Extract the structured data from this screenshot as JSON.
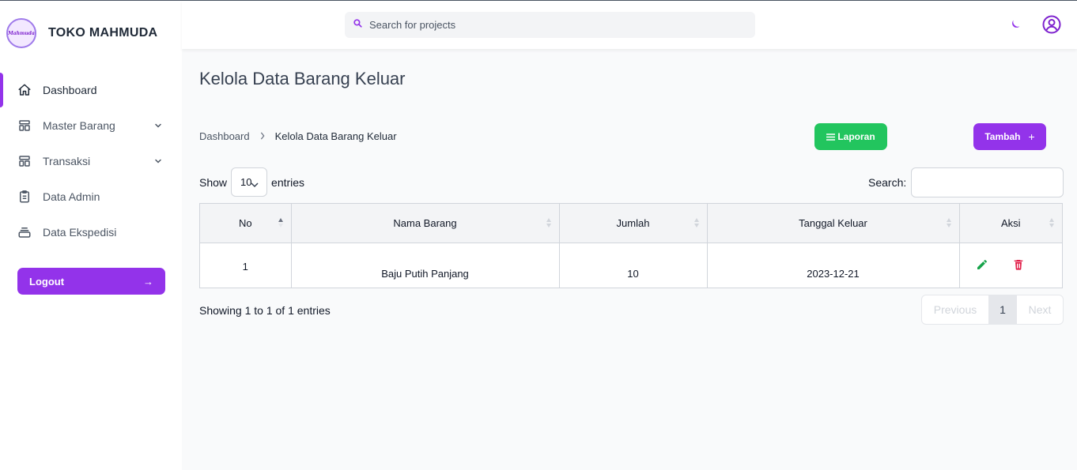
{
  "brand": {
    "logo_text": "Mahmuda",
    "name": "TOKO MAHMUDA"
  },
  "header": {
    "search_placeholder": "Search for projects"
  },
  "sidebar": {
    "items": [
      {
        "label": "Dashboard",
        "icon": "home-icon",
        "active": true
      },
      {
        "label": "Master Barang",
        "icon": "template-icon",
        "expandable": true
      },
      {
        "label": "Transaksi",
        "icon": "template-icon",
        "expandable": true
      },
      {
        "label": "Data Admin",
        "icon": "clipboard-icon"
      },
      {
        "label": "Data Ekspedisi",
        "icon": "archive-icon"
      }
    ],
    "logout_label": "Logout",
    "logout_arrow": "→"
  },
  "main": {
    "title": "Kelola Data Barang Keluar",
    "breadcrumb": {
      "home": "Dashboard",
      "current": "Kelola Data Barang Keluar"
    },
    "laporan_label": "Laporan",
    "tambah_label": "Tambah",
    "tambah_icon": "+"
  },
  "table_controls": {
    "show_label": "Show",
    "entries_value": "10",
    "entries_label": "entries",
    "search_label": "Search:"
  },
  "table": {
    "columns": [
      "No",
      "Nama Barang",
      "Jumlah",
      "Tanggal Keluar",
      "Aksi"
    ],
    "rows": [
      {
        "no": "1",
        "nama_barang": "Baju Putih Panjang",
        "jumlah": "10",
        "tanggal_keluar": "2023-12-21"
      }
    ]
  },
  "footer": {
    "showing": "Showing 1 to 1 of 1 entries",
    "previous": "Previous",
    "page": "1",
    "next": "Next"
  },
  "colors": {
    "primary": "#9333ea",
    "success": "#22c55e",
    "edit": "#16a34a",
    "delete": "#e11d48"
  }
}
